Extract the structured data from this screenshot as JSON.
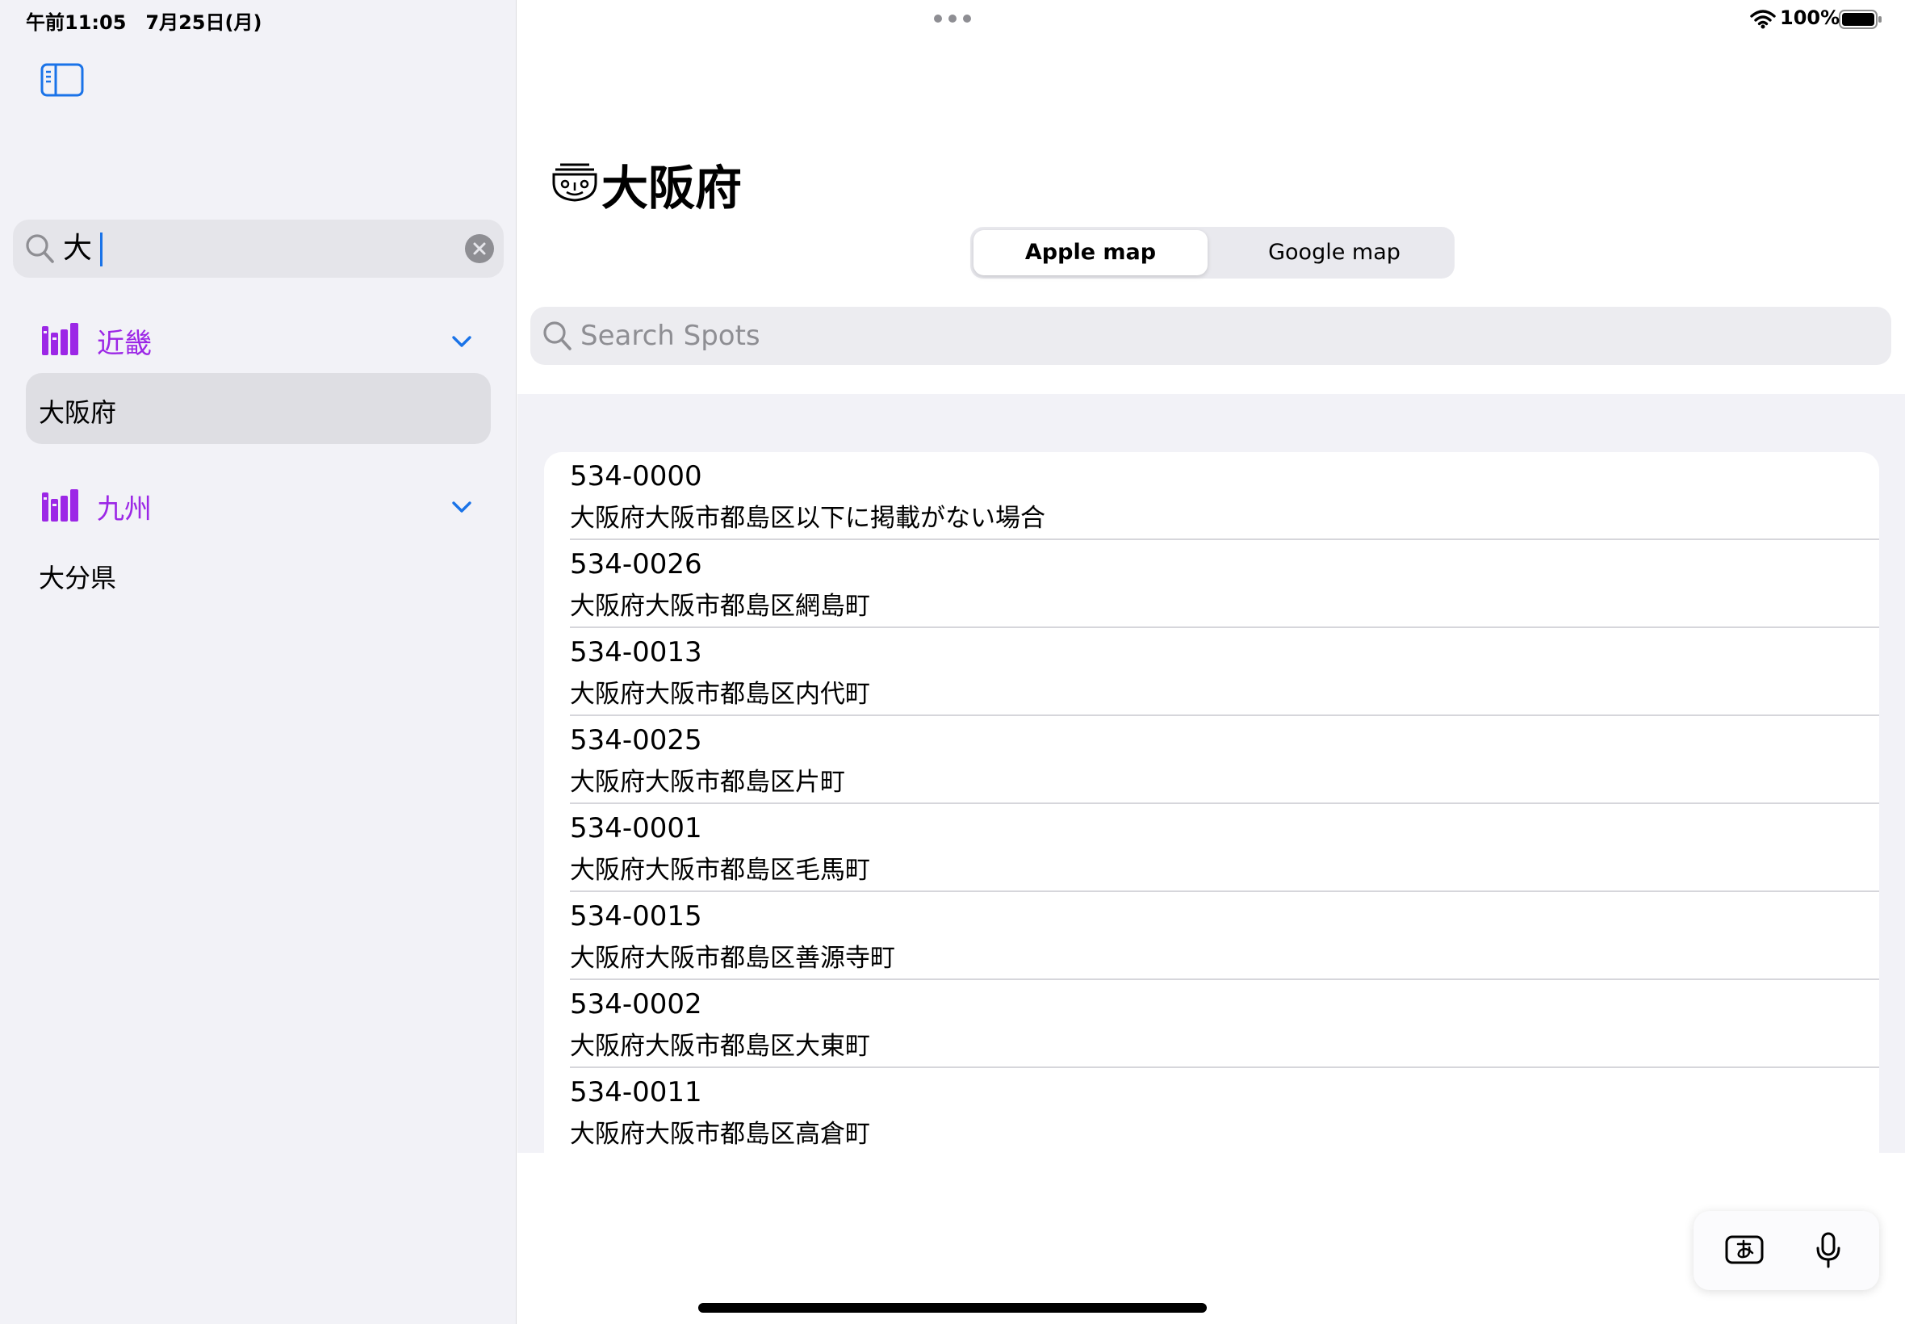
{
  "status_bar": {
    "time_date": "午前11:05　7月25日(月)",
    "battery": "100%"
  },
  "sidebar": {
    "search": {
      "value": "大"
    },
    "sections": [
      {
        "label": "近畿",
        "icon": "books-icon",
        "items": [
          "大阪府"
        ],
        "selected_item": "大阪府"
      },
      {
        "label": "九州",
        "icon": "books-icon",
        "items": [
          "大分県"
        ]
      }
    ]
  },
  "main": {
    "title": "大阪府",
    "title_icon": "prefecture-mascot-icon",
    "segmented": {
      "options": [
        "Apple map",
        "Google map"
      ],
      "selected": "Apple map"
    },
    "search": {
      "placeholder": "Search Spots"
    },
    "spots": [
      {
        "code": "534-0000",
        "address": "大阪府大阪市都島区以下に掲載がない場合"
      },
      {
        "code": "534-0026",
        "address": "大阪府大阪市都島区網島町"
      },
      {
        "code": "534-0013",
        "address": "大阪府大阪市都島区内代町"
      },
      {
        "code": "534-0025",
        "address": "大阪府大阪市都島区片町"
      },
      {
        "code": "534-0001",
        "address": "大阪府大阪市都島区毛馬町"
      },
      {
        "code": "534-0015",
        "address": "大阪府大阪市都島区善源寺町"
      },
      {
        "code": "534-0002",
        "address": "大阪府大阪市都島区大東町"
      },
      {
        "code": "534-0011",
        "address": "大阪府大阪市都島区高倉町"
      }
    ]
  },
  "keyboard_bar": {
    "ime_icon": "japanese-input-icon",
    "mic_icon": "microphone-icon"
  },
  "colors": {
    "section_purple": "#9c27e6",
    "accent_blue": "#1a73e8"
  }
}
